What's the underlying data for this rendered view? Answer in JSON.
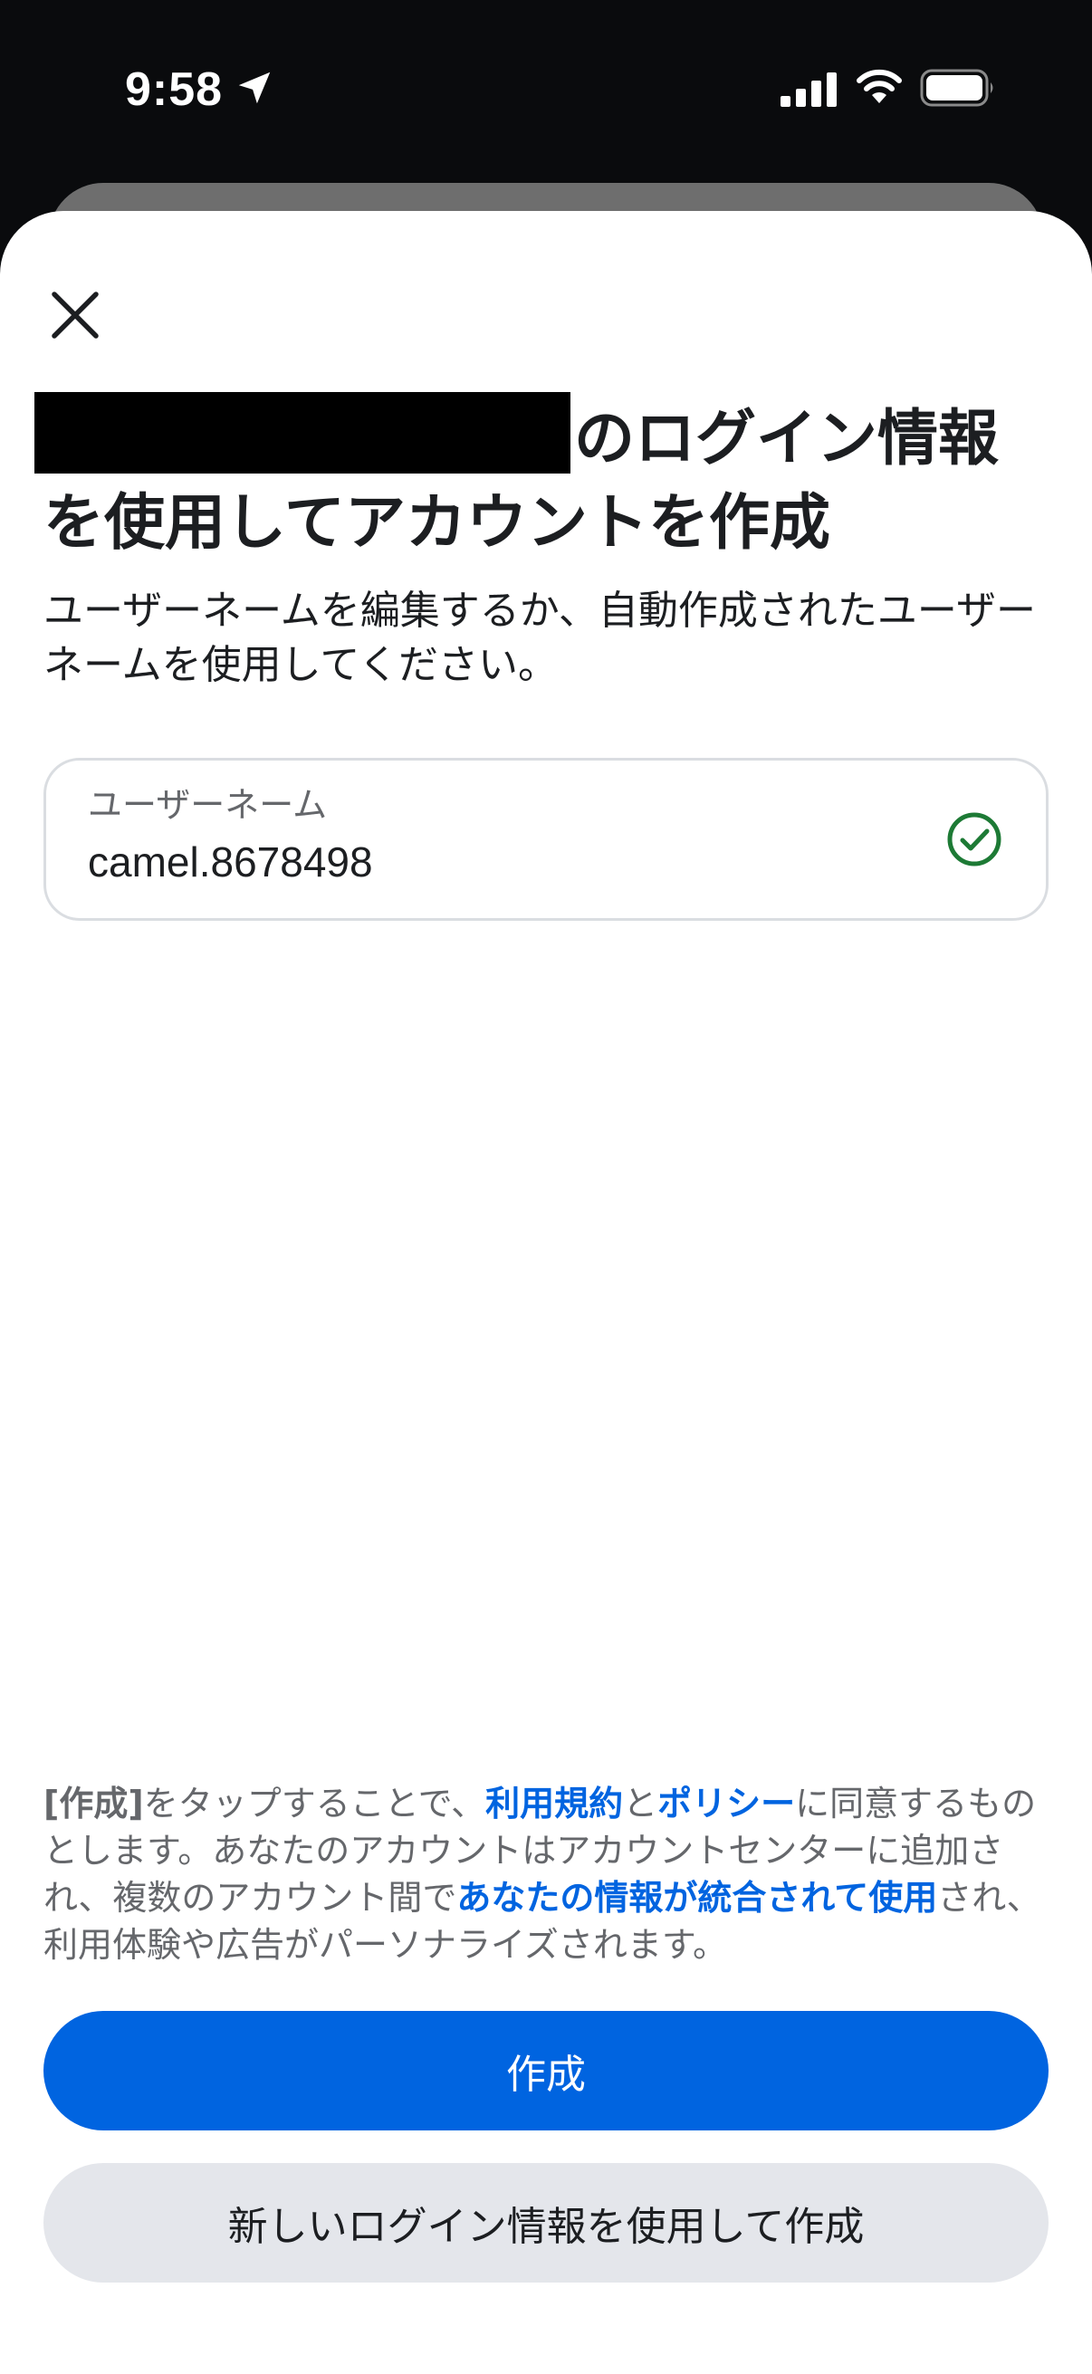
{
  "status_bar": {
    "time": "9:58",
    "icons": [
      "location-arrow-icon",
      "cellular-signal-icon",
      "wifi-icon",
      "battery-icon"
    ]
  },
  "sheet": {
    "close_icon": "close-icon",
    "title_line1": "のログイン情報",
    "title_line2": "を使用してアカウントを作成",
    "subtitle": "ユーザーネームを編集するか、自動作成されたユーザーネームを使用してください。",
    "username_field": {
      "label": "ユーザーネーム",
      "value": "camel.8678498",
      "status_icon": "check-circle-icon"
    },
    "legal": {
      "part1": "[作成]",
      "part2": "をタップすることで、",
      "terms_link": "利用規約",
      "part3": "と",
      "policy_link": "ポリシー",
      "part4": "に同意するものとします。あなたのアカウントはアカウントセンターに追加され、複数のアカウント間で",
      "info_link": "あなたの情報が統合されて使用",
      "part5": "され、利用体験や広告がパーソナライズされます。"
    },
    "create_button": "作成",
    "new_login_button": "新しいログイン情報を使用して作成"
  },
  "colors": {
    "primary": "#0064e0",
    "success": "#1d7a35",
    "status_bar_bg": "#0a0b0d",
    "secondary_button_bg": "#e4e6eb"
  }
}
